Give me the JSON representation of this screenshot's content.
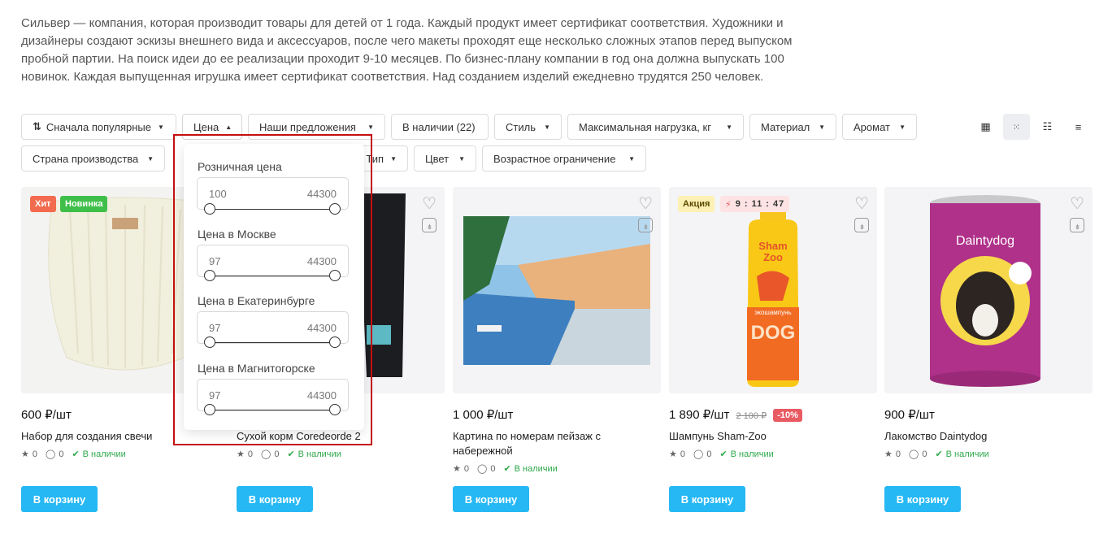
{
  "description": "Сильвер — компания, которая производит товары для детей от 1 года. Каждый продукт имеет сертификат соответствия. Художники и дизайнеры создают эскизы внешнего вида и аксессуаров, после чего макеты проходят еще несколько сложных этапов перед выпуском пробной партии. На поиск идеи до ее реализации проходит 9-10 месяцев. По бизнес-плану компании в год она должна выпускать 100 новинок. Каждая выпущенная игрушка имеет сертификат соответствия. Над созданием изделий ежедневно трудятся 250 человек.",
  "filters": {
    "sort": "Сначала популярные",
    "price": "Цена",
    "offers": "Наши предложения",
    "in_stock": "В наличии (22)",
    "style": "Стиль",
    "max_load": "Максимальная нагрузка, кг",
    "material": "Материал",
    "aroma": "Аромат",
    "country": "Страна производства",
    "type": "Тип",
    "color": "Цвет",
    "age": "Возрастное ограничение"
  },
  "price_dropdown": {
    "groups": [
      {
        "label": "Розничная цена",
        "min": "100",
        "max": "44300"
      },
      {
        "label": "Цена в Москве",
        "min": "97",
        "max": "44300"
      },
      {
        "label": "Цена в Екатеринбурге",
        "min": "97",
        "max": "44300"
      },
      {
        "label": "Цена в Магнитогорске",
        "min": "97",
        "max": "44300"
      }
    ]
  },
  "products": [
    {
      "price": "600 ₽/шт",
      "title": "Набор для создания свечи",
      "rating": "0",
      "reviews": "0",
      "stock": "В наличии",
      "cart": "В корзину",
      "badges": [
        "Хит",
        "Новинка"
      ]
    },
    {
      "price": "",
      "title": "Сухой корм Coredeorde 2",
      "rating": "0",
      "reviews": "0",
      "stock": "В наличии",
      "cart": "В корзину"
    },
    {
      "price": "1 000 ₽/шт",
      "title": "Картина по номерам пейзаж с набережной",
      "rating": "0",
      "reviews": "0",
      "stock": "В наличии",
      "cart": "В корзину"
    },
    {
      "price": "1 890 ₽/шт",
      "old_price": "2 100 ₽",
      "discount": "-10%",
      "title": "Шампунь Sham-Zoo",
      "rating": "0",
      "reviews": "0",
      "stock": "В наличии",
      "cart": "В корзину",
      "badges": [
        "Акция"
      ],
      "timer": "9 : 11 : 47",
      "pack_brand": "Sham Zoo",
      "pack_word": "DOG",
      "pack_sub": "экошампунь"
    },
    {
      "price": "900 ₽/шт",
      "title": "Лакомство Daintydog",
      "rating": "0",
      "reviews": "0",
      "stock": "В наличии",
      "cart": "В корзину",
      "pack_brand": "Daintydog"
    }
  ],
  "colors": {
    "accent": "#25b8f4",
    "hit": "#f26b4e",
    "new": "#3fbf4a",
    "sale_badge": "#fdf0b4",
    "discount": "#e95b63",
    "in_stock": "#2ea94b",
    "highlight": "#c40f0f"
  }
}
